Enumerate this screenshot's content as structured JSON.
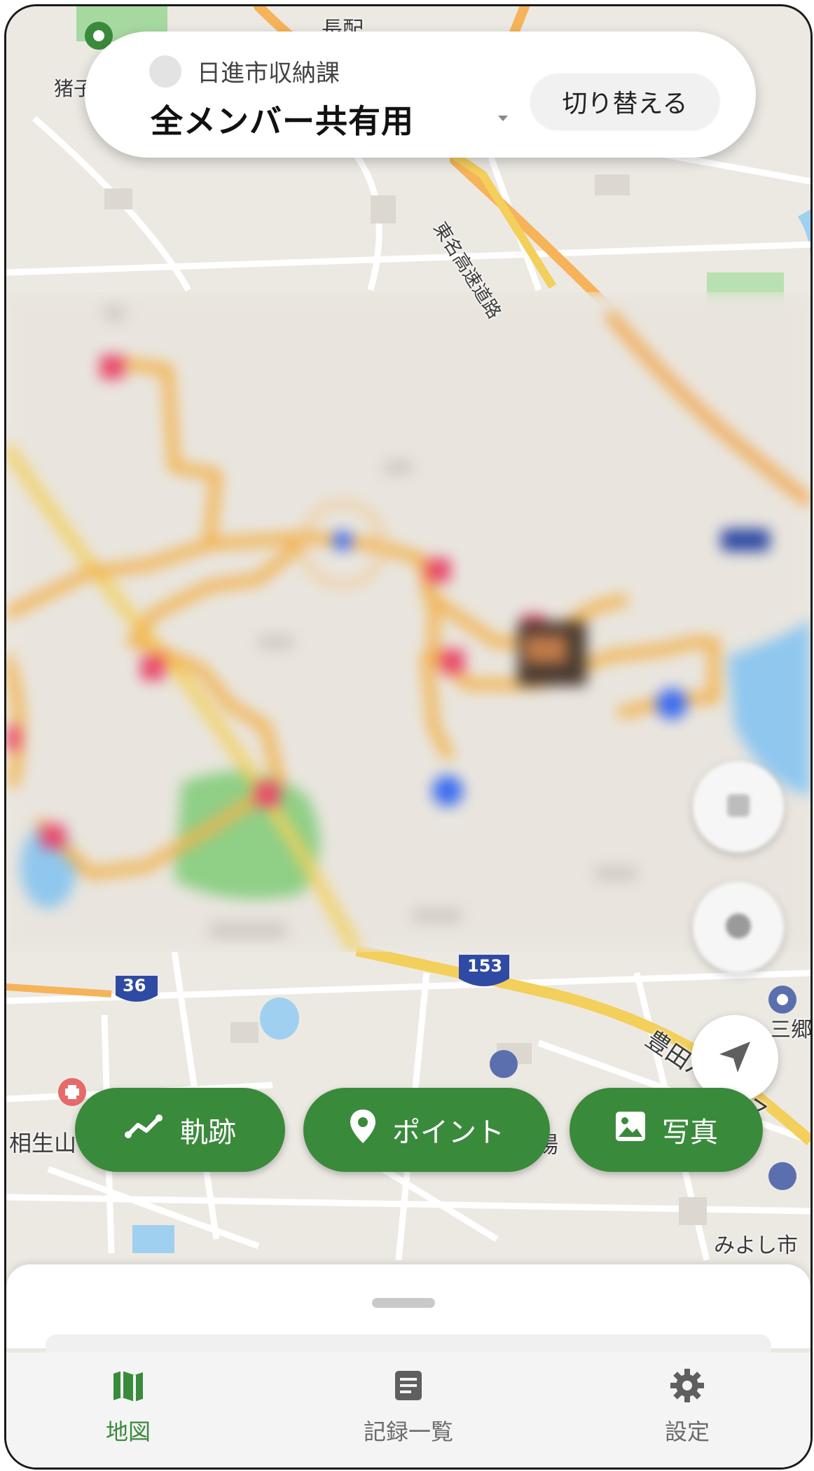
{
  "group_selector": {
    "organization": "日進市収納課",
    "group_name": "全メンバー共有用",
    "switch_label": "切り替える"
  },
  "map": {
    "labels": {
      "nagahara": "長配",
      "inoko": "猪子",
      "expressway": "東名高速道路",
      "route_36": "36",
      "route_153": "153",
      "bypass": "豊田バイパス",
      "aioi": "相生山",
      "miyoshi": "みよし市",
      "sango": "三郷",
      "ba": "場"
    },
    "colors": {
      "land": "#ece9e3",
      "road_major": "#f6b35a",
      "route_marker": "#2f4aa3",
      "water": "#9fd0f0",
      "park": "#a6d9a0",
      "track": "#f2b24e",
      "marker_red": "#e8476a",
      "marker_blue": "#3c6cf0"
    }
  },
  "fab": {
    "layers_icon": "layers-icon",
    "compass_icon": "compass-icon",
    "locate_icon": "navigation-arrow-icon"
  },
  "filters": {
    "track": {
      "label": "軌跡",
      "icon": "track-line-icon"
    },
    "point": {
      "label": "ポイント",
      "icon": "location-pin-icon"
    },
    "photo": {
      "label": "写真",
      "icon": "image-icon"
    }
  },
  "bottom_nav": {
    "items": [
      {
        "label": "地図",
        "icon": "map-icon",
        "active": true
      },
      {
        "label": "記録一覧",
        "icon": "list-document-icon",
        "active": false
      },
      {
        "label": "設定",
        "icon": "gear-icon",
        "active": false
      }
    ]
  },
  "theme": {
    "primary": "#3a8a3c",
    "nav_inactive": "#6b6b6b"
  }
}
